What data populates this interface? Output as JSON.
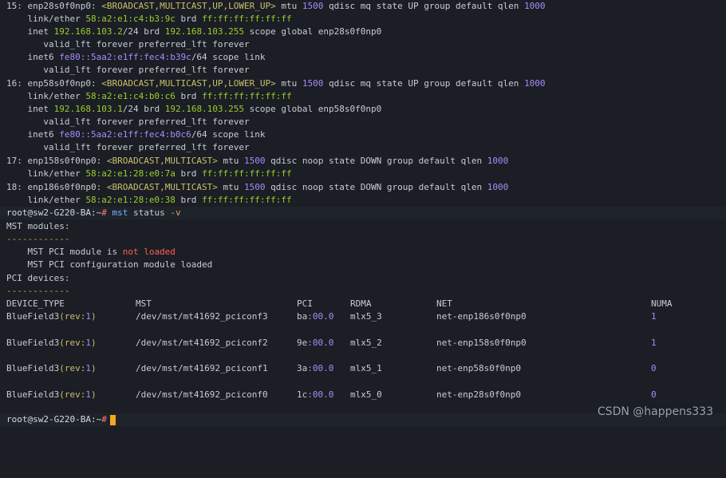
{
  "terminal": {
    "if15": {
      "header": {
        "num": "15: ",
        "name": "enp28s0f0np0: ",
        "flags": "<BROADCAST,MULTICAST,UP,LOWER_UP>",
        "mtu_label": " mtu ",
        "mtu": "1500",
        "rest": " qdisc mq state UP group default qlen ",
        "qlen": "1000"
      },
      "link": {
        "label": "    link/ether ",
        "mac": "58:a2:e1:c4:b3:9c",
        "brd": " brd ",
        "bcast": "ff:ff:ff:ff:ff:ff"
      },
      "inet": {
        "label": "    inet ",
        "ip": "192.168.103.2",
        "mask": "/24",
        "brd": " brd ",
        "bcast": "192.168.103.255",
        "rest": " scope global enp28s0f0np0"
      },
      "valid1": "       valid_lft forever preferred_lft forever",
      "inet6": {
        "label": "    inet6 ",
        "ip": "fe80::5aa2:e1ff:fec4:b39c",
        "mask": "/64",
        "rest": " scope link"
      },
      "valid2": "       valid_lft forever preferred_lft forever"
    },
    "if16": {
      "header": {
        "num": "16: ",
        "name": "enp58s0f0np0: ",
        "flags": "<BROADCAST,MULTICAST,UP,LOWER_UP>",
        "mtu_label": " mtu ",
        "mtu": "1500",
        "rest": " qdisc mq state UP group default qlen ",
        "qlen": "1000"
      },
      "link": {
        "label": "    link/ether ",
        "mac": "58:a2:e1:c4:b0:c6",
        "brd": " brd ",
        "bcast": "ff:ff:ff:ff:ff:ff"
      },
      "inet": {
        "label": "    inet ",
        "ip": "192.168.103.1",
        "mask": "/24",
        "brd": " brd ",
        "bcast": "192.168.103.255",
        "rest": " scope global enp58s0f0np0"
      },
      "valid1": "       valid_lft forever preferred_lft forever",
      "inet6": {
        "label": "    inet6 ",
        "ip": "fe80::5aa2:e1ff:fec4:b0c6",
        "mask": "/64",
        "rest": " scope link"
      },
      "valid2": "       valid_lft forever preferred_lft forever"
    },
    "if17": {
      "header": {
        "num": "17: ",
        "name": "enp158s0f0np0: ",
        "flags": "<BROADCAST,MULTICAST>",
        "mtu_label": " mtu ",
        "mtu": "1500",
        "rest": " qdisc noop state DOWN group default qlen ",
        "qlen": "1000"
      },
      "link": {
        "label": "    link/ether ",
        "mac": "58:a2:e1:28:e0:7a",
        "brd": " brd ",
        "bcast": "ff:ff:ff:ff:ff:ff"
      }
    },
    "if18": {
      "header": {
        "num": "18: ",
        "name": "enp186s0f0np0: ",
        "flags": "<BROADCAST,MULTICAST>",
        "mtu_label": " mtu ",
        "mtu": "1500",
        "rest": " qdisc noop state DOWN group default qlen ",
        "qlen": "1000"
      },
      "link": {
        "label": "    link/ether ",
        "mac": "58:a2:e1:28:e0:38",
        "brd": " brd ",
        "bcast": "ff:ff:ff:ff:ff:ff"
      }
    },
    "prompt1": {
      "user": "root@sw2-G220-BA:~",
      "hash": "#",
      "cmd": " mst",
      "args": " status",
      "flag": " -v"
    },
    "mst_modules": "MST modules:",
    "dashes1": "------------",
    "mod1_prefix": "    MST PCI module is ",
    "mod1_status": "not loaded",
    "mod2": "    MST PCI configuration module loaded",
    "pci_devices": "PCI devices:",
    "dashes2": "------------",
    "table": {
      "headers": {
        "type": "DEVICE_TYPE",
        "mst": "MST",
        "pci": "PCI",
        "rdma": "RDMA",
        "net": "NET",
        "numa": "NUMA"
      },
      "rows": [
        {
          "type_a": "BlueField3",
          "type_b": "(rev:",
          "type_c": "1",
          "type_d": ")",
          "mst": "/dev/mst/mt41692_pciconf3",
          "pci_a": "ba",
          "pci_b": ":00.0",
          "rdma": "mlx5_3",
          "net": "net-enp186s0f0np0",
          "numa": "1"
        },
        {
          "type_a": "BlueField3",
          "type_b": "(rev:",
          "type_c": "1",
          "type_d": ")",
          "mst": "/dev/mst/mt41692_pciconf2",
          "pci_a": "9e",
          "pci_b": ":00.0",
          "rdma": "mlx5_2",
          "net": "net-enp158s0f0np0",
          "numa": "1"
        },
        {
          "type_a": "BlueField3",
          "type_b": "(rev:",
          "type_c": "1",
          "type_d": ")",
          "mst": "/dev/mst/mt41692_pciconf1",
          "pci_a": "3a",
          "pci_b": ":00.0",
          "rdma": "mlx5_1",
          "net": "net-enp58s0f0np0",
          "numa": "0"
        },
        {
          "type_a": "BlueField3",
          "type_b": "(rev:",
          "type_c": "1",
          "type_d": ")",
          "mst": "/dev/mst/mt41692_pciconf0",
          "pci_a": "1c",
          "pci_b": ":00.0",
          "rdma": "mlx5_0",
          "net": "net-enp28s0f0np0",
          "numa": "0"
        }
      ]
    },
    "prompt2": {
      "user": "root@sw2-G220-BA:~",
      "hash": "#"
    }
  },
  "watermark": "CSDN @happens333",
  "colors": {
    "background": "#1b1e24",
    "mac": "#9acd32",
    "number": "#a78bfa",
    "error": "#ff5f56",
    "cursor": "#f5a623"
  }
}
